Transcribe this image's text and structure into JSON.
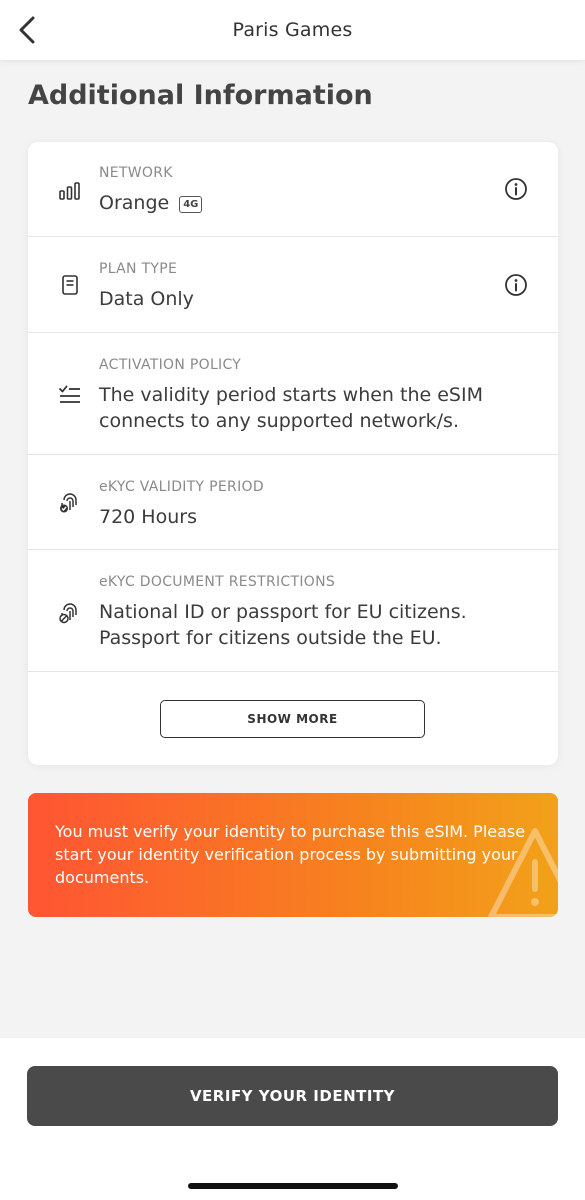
{
  "header": {
    "title": "Paris Games"
  },
  "section_title": "Additional Information",
  "rows": [
    {
      "label": "NETWORK",
      "value": "Orange",
      "badge": "4G",
      "icon": "signal-bars-icon",
      "has_info": true
    },
    {
      "label": "PLAN TYPE",
      "value": "Data Only",
      "icon": "document-icon",
      "has_info": true
    },
    {
      "label": "ACTIVATION POLICY",
      "value": "The validity period starts when the eSIM connects to any supported network/s.",
      "icon": "checklist-icon",
      "has_info": false
    },
    {
      "label": "eKYC VALIDITY PERIOD",
      "value": "720 Hours",
      "icon": "fingerprint-check-icon",
      "has_info": false
    },
    {
      "label": "eKYC DOCUMENT RESTRICTIONS",
      "value": "National ID or passport for EU citizens. Passport for citizens outside the EU.",
      "icon": "fingerprint-block-icon",
      "has_info": false
    }
  ],
  "show_more_label": "SHOW MORE",
  "alert": {
    "text": "You must verify your identity to purchase this eSIM. Please start your identity verification process by submitting your documents.",
    "icon": "warning-triangle-icon",
    "colors": {
      "start": "#ff5533",
      "end": "#f2a11a"
    }
  },
  "footer": {
    "verify_label": "VERIFY YOUR IDENTITY",
    "button_color": "#4a4a4a"
  }
}
